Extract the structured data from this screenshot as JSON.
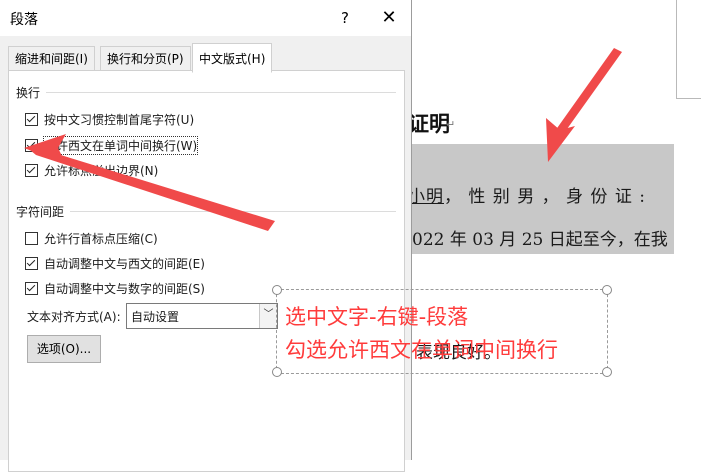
{
  "dialog": {
    "title": "段落",
    "help_label": "?",
    "close_label": "✕",
    "tabs": [
      {
        "label": "缩进和间距(I)"
      },
      {
        "label": "换行和分页(P)"
      },
      {
        "label": "中文版式(H)",
        "active": true
      }
    ],
    "line_break_group": {
      "label": "换行",
      "options": [
        {
          "label": "按中文习惯控制首尾字符(U)",
          "checked": true
        },
        {
          "label": "允许西文在单词中间换行(W)",
          "checked": true
        },
        {
          "label": "允许标点溢出边界(N)",
          "checked": true
        }
      ]
    },
    "char_spacing_group": {
      "label": "字符间距",
      "options": [
        {
          "label": "允许行首标点压缩(C)",
          "checked": false
        },
        {
          "label": "自动调整中文与西文的间距(E)",
          "checked": true
        },
        {
          "label": "自动调整中文与数字的间距(S)",
          "checked": true
        }
      ]
    },
    "text_alignment": {
      "label": "文本对齐方式(A):",
      "value": "自动设置"
    },
    "options_button": "选项(O)..."
  },
  "document": {
    "heading": "证明",
    "paragraph_mark": "↵",
    "line1_prefix": "",
    "line1_name": "小明",
    "line1_rest": "， 性 别 男 ， 身 份 证 :",
    "line2": "022 年 03 月 25 日起至今，在我",
    "line3": "表现良好。"
  },
  "annotation": {
    "line1": "选中文字-右键-段落",
    "line2": "勾选允许西文在单词中间换行",
    "color": "#ff3b3b"
  },
  "colors": {
    "selection": "#c8c8c8",
    "dialog_bg": "#f0f0f0",
    "arrow": "#f04a4a"
  }
}
